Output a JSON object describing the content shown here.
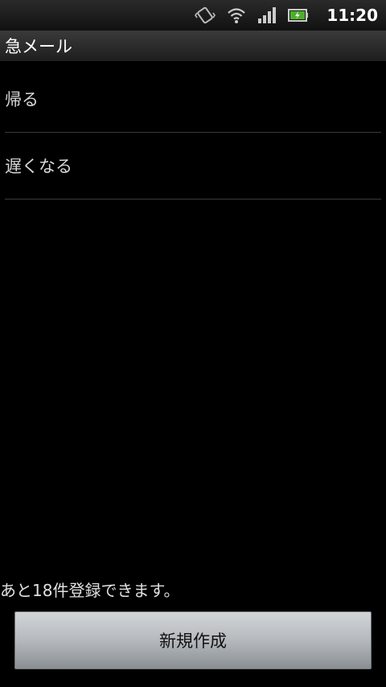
{
  "status_bar": {
    "time": "11:20",
    "icons": [
      "vibrate-icon",
      "wifi-icon",
      "signal-icon",
      "battery-charging-icon"
    ]
  },
  "title_bar": {
    "title": "急メール"
  },
  "list": {
    "items": [
      {
        "label": "帰る"
      },
      {
        "label": "遅くなる"
      }
    ]
  },
  "footer": {
    "remaining_text": "あと18件登録できます。",
    "new_button_label": "新規作成"
  }
}
